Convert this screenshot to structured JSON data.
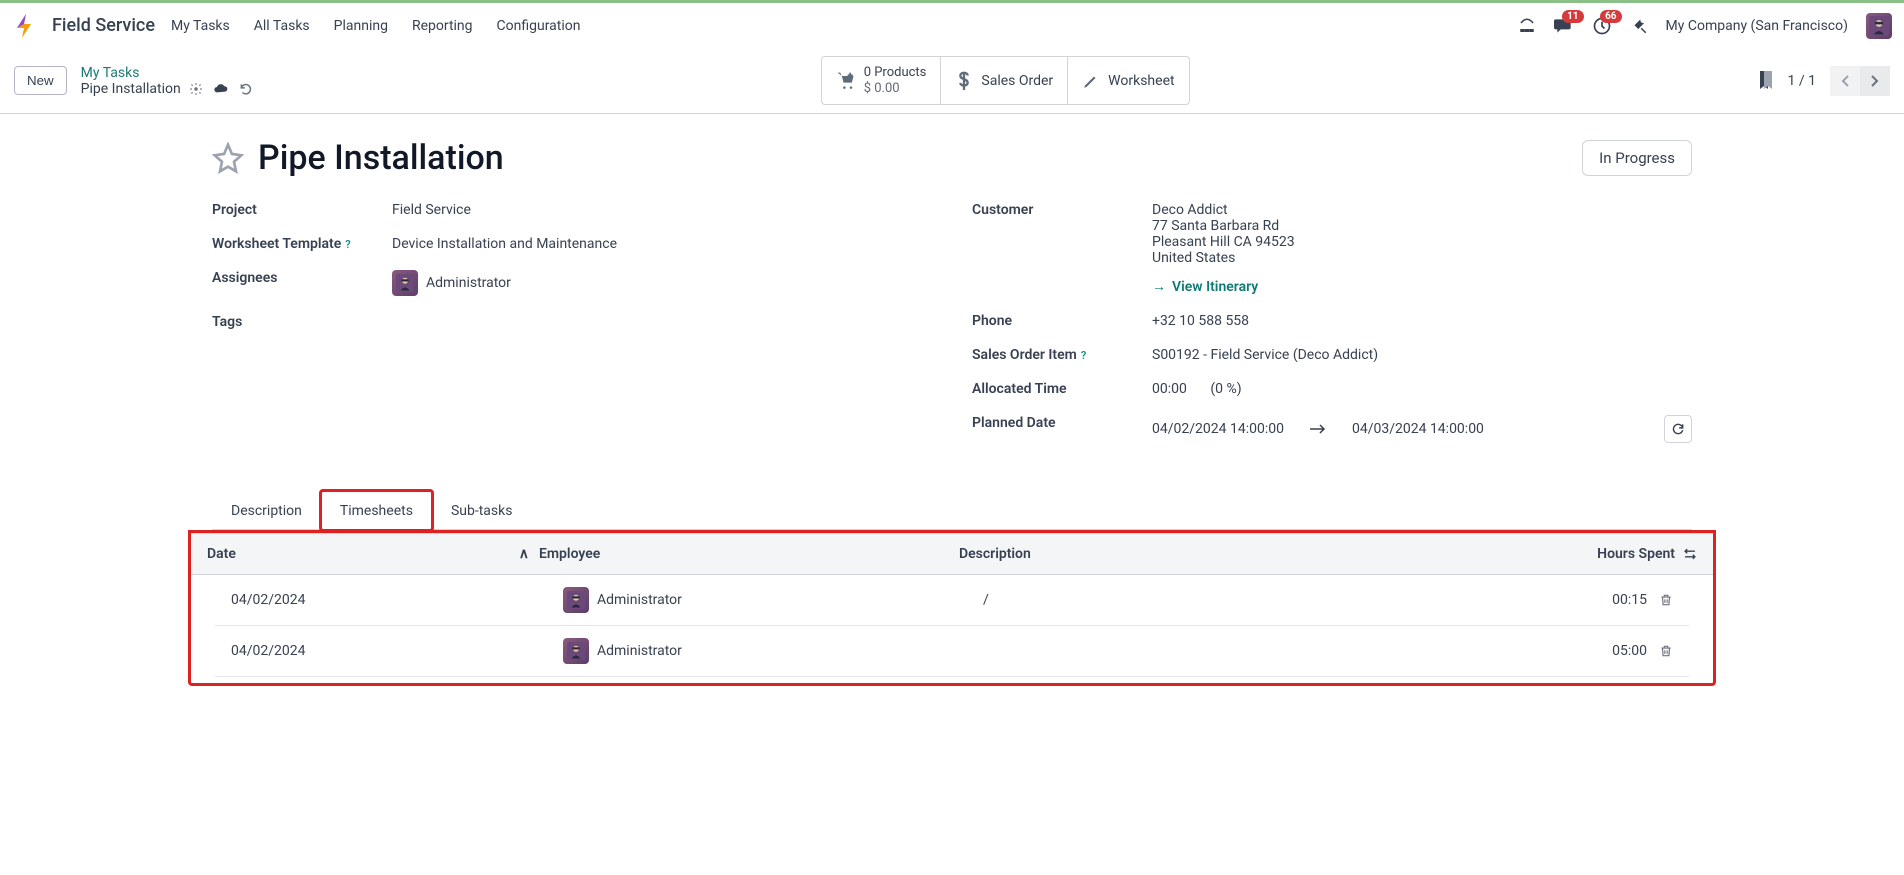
{
  "header": {
    "app_name": "Field Service",
    "nav": [
      "My Tasks",
      "All Tasks",
      "Planning",
      "Reporting",
      "Configuration"
    ],
    "msg_badge": "11",
    "activity_badge": "66",
    "company": "My Company (San Francisco)"
  },
  "subbar": {
    "new_btn": "New",
    "breadcrumb_link": "My Tasks",
    "breadcrumb_current": "Pipe Installation",
    "products_label": "0 Products",
    "products_amount": "$ 0.00",
    "sales_order": "Sales Order",
    "worksheet": "Worksheet",
    "pager": "1 / 1"
  },
  "record": {
    "title": "Pipe Installation",
    "status": "In Progress",
    "labels": {
      "project": "Project",
      "worksheet_template": "Worksheet Template",
      "assignees": "Assignees",
      "tags": "Tags",
      "customer": "Customer",
      "phone": "Phone",
      "sales_order_item": "Sales Order Item",
      "allocated_time": "Allocated Time",
      "planned_date": "Planned Date"
    },
    "values": {
      "project": "Field Service",
      "worksheet_template": "Device Installation and Maintenance",
      "assignee": "Administrator",
      "customer_name": "Deco Addict",
      "customer_street": "77 Santa Barbara Rd",
      "customer_city": "Pleasant Hill CA 94523",
      "customer_country": "United States",
      "view_itinerary": "View Itinerary",
      "phone": "+32 10 588 558",
      "sales_order_item": "S00192 - Field Service (Deco Addict)",
      "allocated_time": "00:00",
      "allocated_pct": "(0 %)",
      "planned_start": "04/02/2024 14:00:00",
      "planned_end": "04/03/2024 14:00:00"
    }
  },
  "tabs": {
    "description": "Description",
    "timesheets": "Timesheets",
    "subtasks": "Sub-tasks"
  },
  "table": {
    "headers": {
      "date": "Date",
      "employee": "Employee",
      "description": "Description",
      "hours": "Hours Spent"
    },
    "rows": [
      {
        "date": "04/02/2024",
        "employee": "Administrator",
        "description": "/",
        "hours": "00:15"
      },
      {
        "date": "04/02/2024",
        "employee": "Administrator",
        "description": "",
        "hours": "05:00"
      }
    ]
  }
}
